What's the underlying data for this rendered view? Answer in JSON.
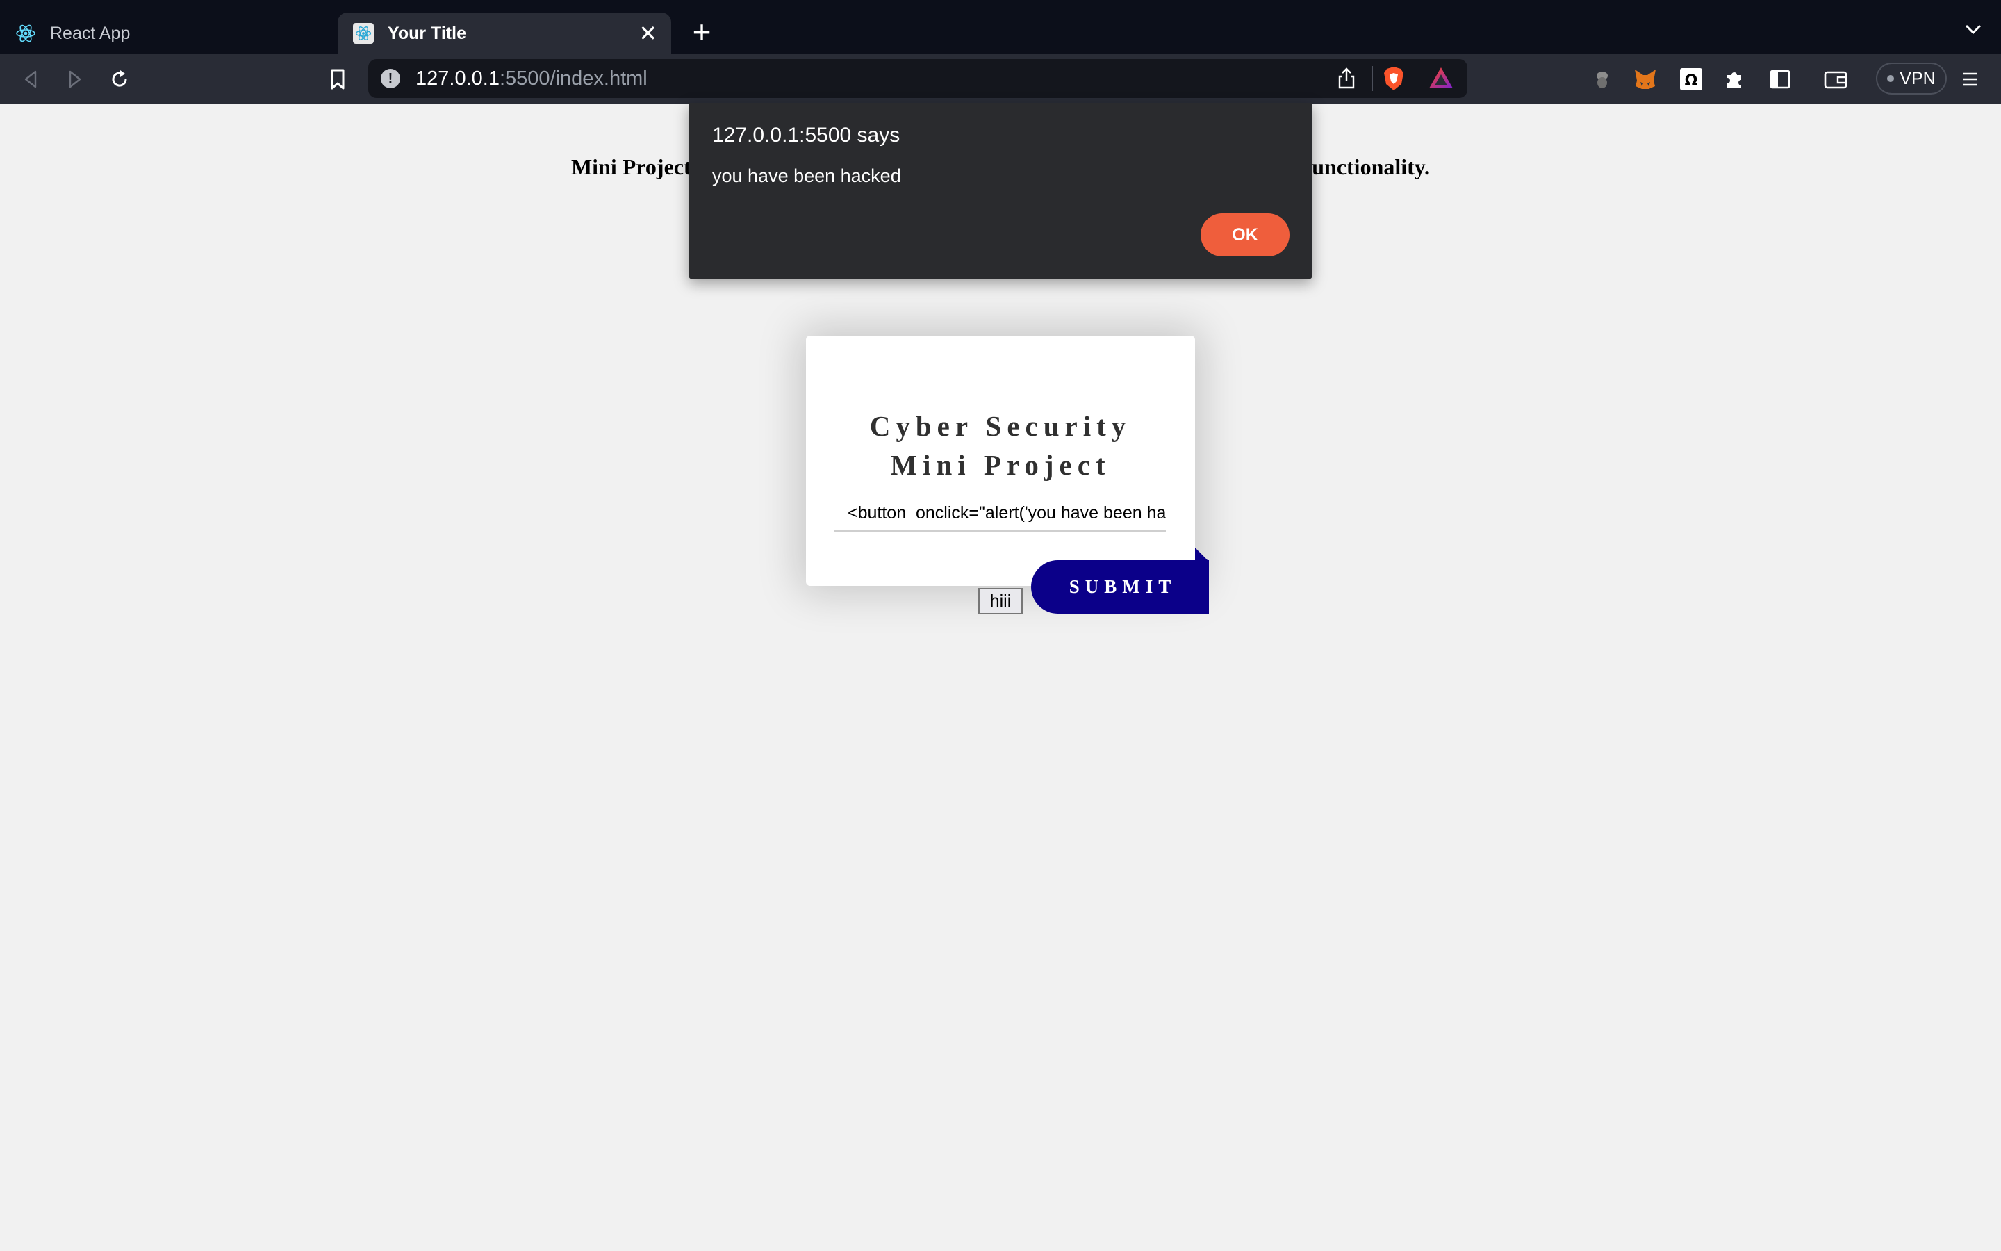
{
  "browser": {
    "tabs": [
      {
        "title": "React App",
        "active": false
      },
      {
        "title": "Your Title",
        "active": true
      }
    ],
    "new_tab_icon": "plus-icon",
    "url": {
      "host": "127.0.0.1",
      "path": ":5500/index.html"
    },
    "vpn_label": "VPN"
  },
  "page": {
    "heading": "Mini Project 1: Implement Cross Site Scripting vulnerability in the comment functionality.",
    "card": {
      "title_line1": "Cyber Security",
      "title_line2": "Mini Project",
      "comment_value": "<button  onclick=\"alert('you have been hacked')\">hiii</button>",
      "injected_button_label": "hiii",
      "submit_label": "SUBMIT"
    }
  },
  "alert": {
    "title": "127.0.0.1:5500 says",
    "message": "you have been hacked",
    "ok_label": "OK",
    "ok_color": "#ef5e3c"
  },
  "colors": {
    "submit_button": "#0b0089",
    "page_background": "#f1f1f1",
    "tabstrip": "#0c0f1a",
    "toolbar": "#292c36"
  }
}
